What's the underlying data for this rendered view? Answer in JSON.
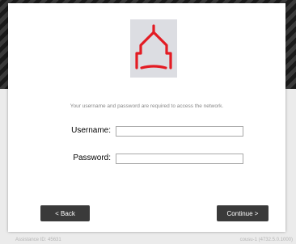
{
  "logo": {
    "icon": "schoolhouse-logo",
    "color": "#e31b23",
    "background": "#dcdde2"
  },
  "form": {
    "message": "Your username and password are required to access the network.",
    "username_label": "Username:",
    "username_value": "",
    "password_label": "Password:",
    "password_value": ""
  },
  "buttons": {
    "back_label": "< Back",
    "continue_label": "Continue >"
  },
  "footer": {
    "assistance_id": "Assistance ID: 45631",
    "version": "cousu-1 (4732.5.0.1000)"
  },
  "colors": {
    "button": "#3a3a3a",
    "page_background": "#ebebeb"
  }
}
